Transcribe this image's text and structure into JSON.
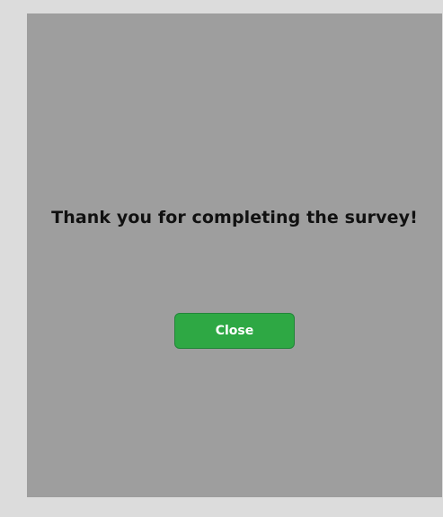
{
  "dialog": {
    "message": "Thank you for completing the survey!",
    "close_label": "Close"
  },
  "colors": {
    "page_background": "#dcdcdc",
    "panel_background": "#9e9e9e",
    "button_background": "#2ea844",
    "button_text": "#ffffff",
    "message_text": "#111111"
  }
}
